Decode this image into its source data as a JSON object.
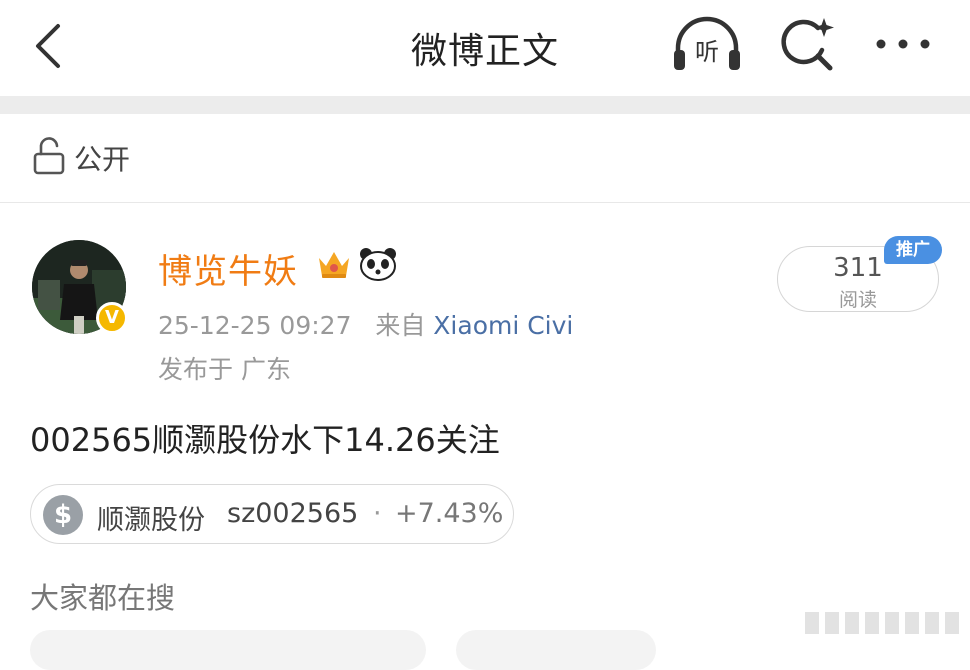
{
  "header": {
    "title": "微博正文",
    "listen_label": "听"
  },
  "visibility": {
    "label": "公开"
  },
  "post": {
    "author": "博览牛妖",
    "verified_mark": "V",
    "timestamp": "25-12-25 09:27",
    "source_prefix": "来自",
    "source": "Xiaomi Civi",
    "location": "发布于 广东",
    "reads_count": "311",
    "reads_label": "阅读",
    "promo_badge": "推广",
    "text": "002565顺灏股份水下14.26关注"
  },
  "stock_card": {
    "icon_glyph": "$",
    "name": "顺灏股份",
    "code": "sz002565",
    "separator": "·",
    "change": "+7.43%"
  },
  "trending": {
    "title": "大家都在搜"
  },
  "colors": {
    "author": "#f07c14",
    "source_link": "#4a6fa5",
    "promo_badge": "#4a90e2",
    "verified_badge": "#f5b800",
    "divider": "#ececec"
  },
  "icons": [
    "back-icon",
    "listen-icon",
    "ai-search-icon",
    "more-icon",
    "lock-open-icon",
    "crown-icon",
    "panda-icon",
    "dollar-icon"
  ]
}
